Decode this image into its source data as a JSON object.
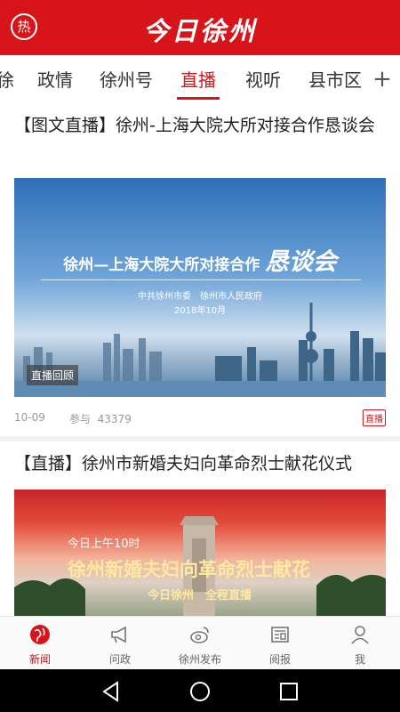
{
  "header": {
    "hot_label": "热",
    "title": "今日徐州"
  },
  "tabs": [
    {
      "label": "徐"
    },
    {
      "label": "政情"
    },
    {
      "label": "徐州号"
    },
    {
      "label": "直播"
    },
    {
      "label": "视听"
    },
    {
      "label": "县市区"
    }
  ],
  "tabs_more": "+",
  "articles": [
    {
      "title": "【图文直播】徐州-上海大院大所对接合作恳谈会",
      "cover_main": "徐州—上海大院大所对接合作",
      "cover_big": "恳谈会",
      "cover_sub": "中共徐州市委　徐州市人民政府",
      "cover_date": "2018年10月",
      "replay_badge": "直播回顾",
      "date": "10-09",
      "views_label": "参与",
      "views": "43379",
      "tag": "直播"
    },
    {
      "title": "【直播】徐州市新婚夫妇向革命烈士献花仪式",
      "cover_line1": "今日上午10时",
      "cover_line2": "徐州新婚夫妇向革命烈士献花",
      "cover_line3": "今日徐州　全程直播"
    }
  ],
  "bottom_nav": [
    {
      "label": "新闻",
      "icon": "globe-icon"
    },
    {
      "label": "问政",
      "icon": "megaphone-icon"
    },
    {
      "label": "徐州发布",
      "icon": "weibo-icon"
    },
    {
      "label": "阅报",
      "icon": "newspaper-icon"
    },
    {
      "label": "我",
      "icon": "person-icon"
    }
  ],
  "colors": {
    "brand_red": "#d7141a"
  }
}
